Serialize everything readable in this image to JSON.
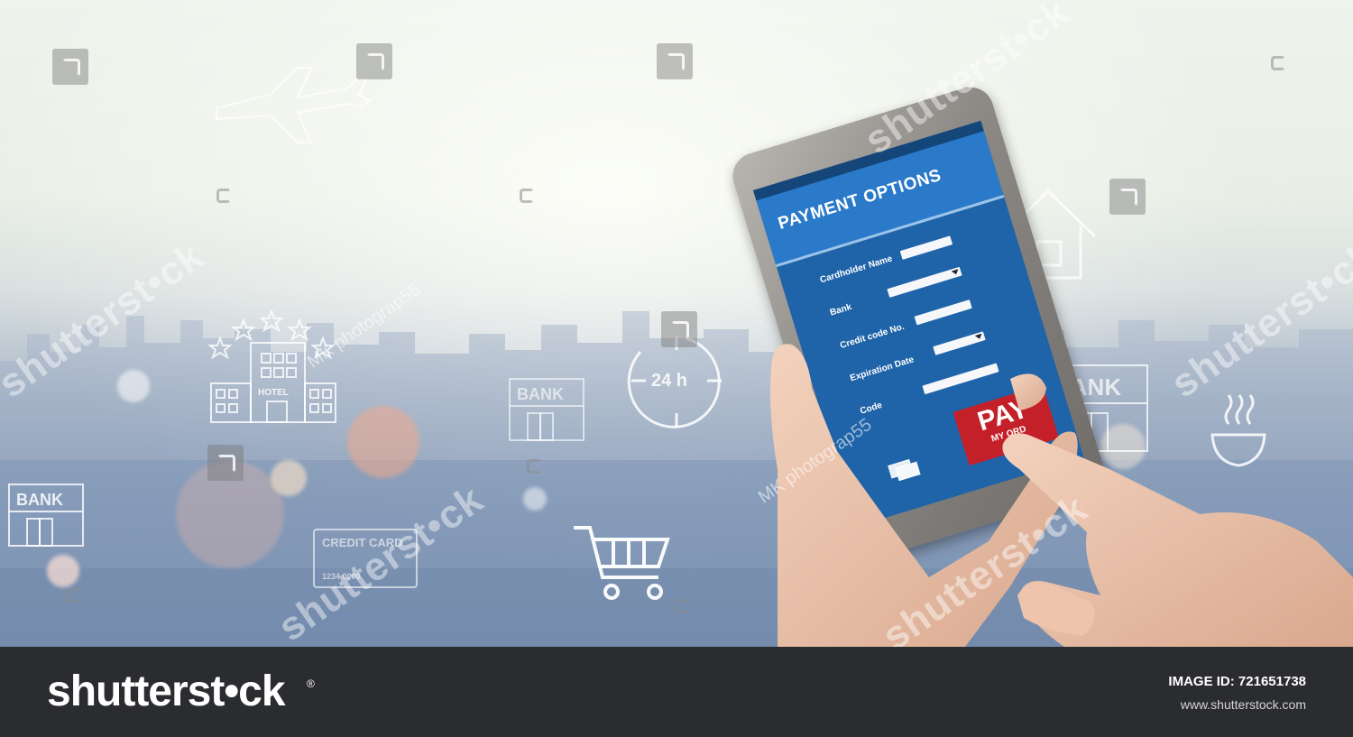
{
  "phone_screen": {
    "title": "PAYMENT  OPTIONS",
    "fields": [
      {
        "label": "Cardholder  Name",
        "dropdown": false
      },
      {
        "label": "Bank",
        "dropdown": true
      },
      {
        "label": "Credit code No.",
        "dropdown": false
      },
      {
        "label": "Expiration Date",
        "dropdown": true
      },
      {
        "label": "Code",
        "dropdown": false
      }
    ],
    "pay_button": {
      "main": "PAY",
      "sub": "MY ORD"
    }
  },
  "background_icons": {
    "bank_labels": [
      "BANK",
      "BANK",
      "BANK"
    ],
    "hotel_label": "HOTEL",
    "clock_label": "24 h",
    "credit_card_label": "CREDIT CARD",
    "card_number": "1234 0000"
  },
  "watermarks": {
    "brand_text": "shutterst•ck",
    "photographer_text": "MK photograp55"
  },
  "footer": {
    "logo_text": "shutterst•ck",
    "registered_mark": "®",
    "image_id_label": "IMAGE ID: 721651738",
    "site_url": "www.shutterstock.com"
  },
  "colors": {
    "screen_blue": "#1f64a8",
    "header_blue": "#2a7ac9",
    "pay_red": "#c4202a",
    "footer_bg": "#2b2c30"
  }
}
